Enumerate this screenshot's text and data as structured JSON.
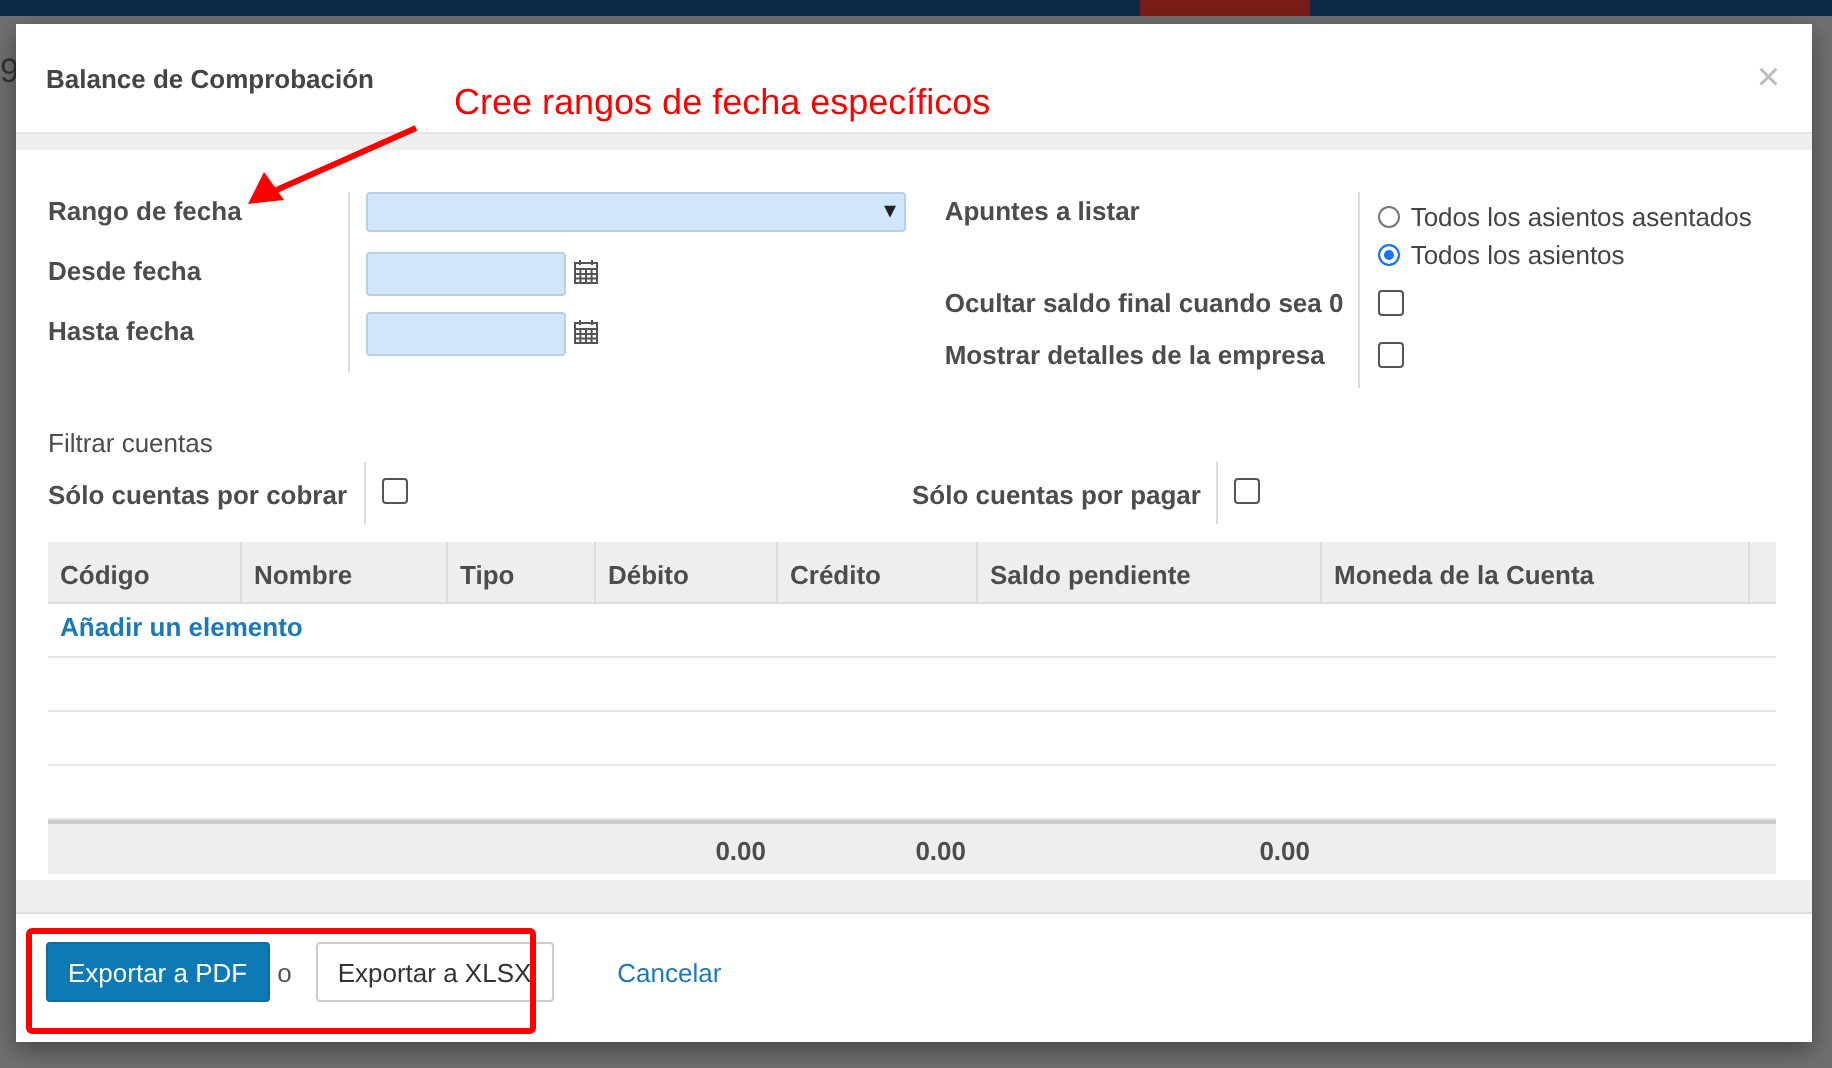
{
  "background": {
    "fragment": "9"
  },
  "dialog": {
    "title": "Balance de Comprobación",
    "close": "×"
  },
  "annotation": {
    "text": "Cree rangos de fecha específicos"
  },
  "left_fields": [
    {
      "label": "Rango de fecha",
      "kind": "select",
      "caret": "▾"
    },
    {
      "label": "Desde fecha",
      "kind": "date"
    },
    {
      "label": "Hasta fecha",
      "kind": "date"
    }
  ],
  "right_fields": [
    {
      "label": "Apuntes a listar",
      "kind": "radio",
      "options": [
        {
          "label": "Todos los asientos asentados",
          "selected": false
        },
        {
          "label": "Todos los asientos",
          "selected": true
        }
      ]
    },
    {
      "label": "Ocultar saldo final cuando sea 0",
      "kind": "checkbox",
      "checked": false
    },
    {
      "label": "Mostrar detalles de la empresa",
      "kind": "checkbox",
      "checked": false
    }
  ],
  "filter": {
    "title": "Filtrar cuentas",
    "checks": [
      {
        "label": "Sólo cuentas por cobrar",
        "checked": false
      },
      {
        "label": "Sólo cuentas por pagar",
        "checked": false
      }
    ]
  },
  "table": {
    "columns": [
      {
        "label": "Código"
      },
      {
        "label": "Nombre"
      },
      {
        "label": "Tipo"
      },
      {
        "label": "Débito",
        "total": "0.00"
      },
      {
        "label": "Crédito",
        "total": "0.00"
      },
      {
        "label": "Saldo pendiente",
        "total": "0.00"
      },
      {
        "label": "Moneda de la Cuenta"
      }
    ],
    "add_link": "Añadir un elemento"
  },
  "footer": {
    "buttons": [
      {
        "label": "Exportar a PDF",
        "kind": "primary"
      },
      {
        "label": "Exportar a XLSX",
        "kind": "secondary"
      }
    ],
    "separator": "o",
    "cancel": "Cancelar",
    "highlighted": true
  }
}
